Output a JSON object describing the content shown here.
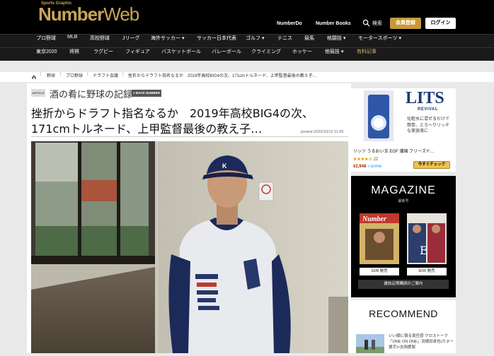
{
  "header": {
    "logo_small": "Sports Graphic",
    "logo_main_bold": "Number",
    "logo_main_light": "Web",
    "links": [
      "NumberDo",
      "Number Books"
    ],
    "search_label": "検索",
    "member_btn": "会員登録",
    "login_btn": "ログイン"
  },
  "nav_row1": [
    "プロ野球",
    "MLB",
    "高校野球",
    "Jリーグ",
    "海外サッカー ▾",
    "サッカー日本代表",
    "ゴルフ ▾",
    "テニス",
    "競馬",
    "格闘技 ▾",
    "モータースポーツ ▾"
  ],
  "nav_row2": [
    "東京2020",
    "将棋",
    "ラグビー",
    "フィギュア",
    "バスケットボール",
    "バレーボール",
    "クライミング",
    "ホッケー",
    "他競技 ▾",
    "有料記事"
  ],
  "breadcrumb": [
    "野球",
    "プロ野球",
    "ドラフト会議",
    "挫折からドラフト指名なるか　2019年高校BIG4の次、171cmトルネード、上甲監督最後の教え子…"
  ],
  "article": {
    "badge": "ARTICLE",
    "series": "酒の肴に野球の記録",
    "back_btn": "< BACK NUMBER",
    "title_line1": "挫折からドラフト指名なるか　2019年高校BIG4の次、",
    "title_line2": "171cmトルネード、上甲監督最後の教え子…",
    "posted": "posted 2020/10/12 11:00"
  },
  "ad": {
    "brand": "LITS",
    "brand_sub": "REVIVAL",
    "copy": "化粧水に混ぜるだけで簡単、とろ〜りリッチな美容液に",
    "product": "リッツ うるおい玉 EGF 濃縮 フリーズド…",
    "stars": "★★★★☆",
    "review_count": "22",
    "price": "¥2,948",
    "prime": "✓prime",
    "button": "今すぐチェック"
  },
  "magazine": {
    "title": "MAGAZINE",
    "subtitle": "最新号",
    "covers": [
      {
        "date": "10/8 発売"
      },
      {
        "date": "9/26 発売"
      }
    ],
    "subscribe": "雑誌定期購読のご案内"
  },
  "recommend": {
    "title": "RECOMMEND",
    "item_text": "いい顔に宿る責任感 クロストーク「ONE ON ONE」羽根田卓也(カヌー選手)×吉岡愛梨"
  },
  "colors": {
    "gold": "#c9a654",
    "member_btn": "#c69a3a",
    "header_bg": "#000000",
    "nav_bg": "#1a1a1a"
  }
}
